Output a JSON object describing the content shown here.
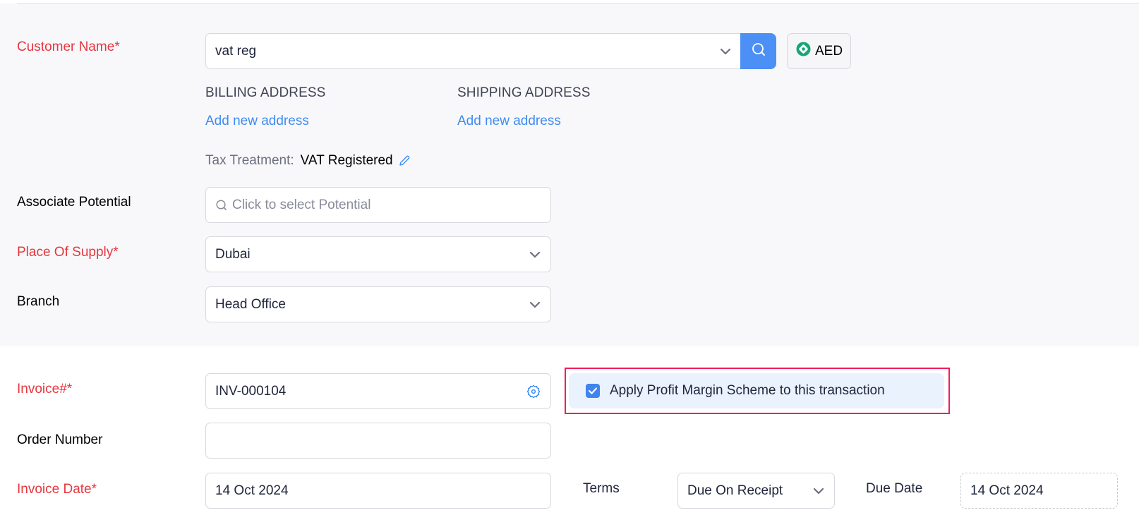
{
  "customer_section": {
    "customer_name": {
      "label": "Customer Name*",
      "value": "vat reg",
      "search_icon": "search-icon",
      "dropdown_icon": "chevron-down-icon"
    },
    "currency": {
      "icon": "currency-badge-icon",
      "label": "AED",
      "icon_color": "#17a673"
    },
    "billing_address": {
      "heading": "BILLING ADDRESS",
      "link": "Add new address"
    },
    "shipping_address": {
      "heading": "SHIPPING ADDRESS",
      "link": "Add new address"
    },
    "tax_treatment": {
      "label": "Tax Treatment:",
      "value": "VAT Registered",
      "edit_icon": "pencil-icon"
    },
    "associate_potential": {
      "label": "Associate Potential",
      "placeholder": "Click to select Potential"
    },
    "place_of_supply": {
      "label": "Place Of Supply*",
      "value": "Dubai"
    },
    "branch": {
      "label": "Branch",
      "value": "Head Office"
    }
  },
  "invoice_section": {
    "invoice_number": {
      "label": "Invoice#*",
      "value": "INV-000104",
      "settings_icon": "gear-icon"
    },
    "profit_margin_scheme": {
      "label": "Apply Profit Margin Scheme to this transaction",
      "checked": true
    },
    "order_number": {
      "label": "Order Number",
      "value": ""
    },
    "invoice_date": {
      "label": "Invoice Date*",
      "value": "14 Oct 2024"
    },
    "terms": {
      "label": "Terms",
      "value": "Due On Receipt"
    },
    "due_date": {
      "label": "Due Date",
      "value": "14 Oct 2024"
    }
  },
  "colors": {
    "required_label": "#e5373f",
    "link": "#3f8cf0",
    "primary_button": "#4c8ff5",
    "highlight_border": "#f01f5b",
    "checkbox": "#3f84ef",
    "section_background": "#f8f8fb"
  }
}
